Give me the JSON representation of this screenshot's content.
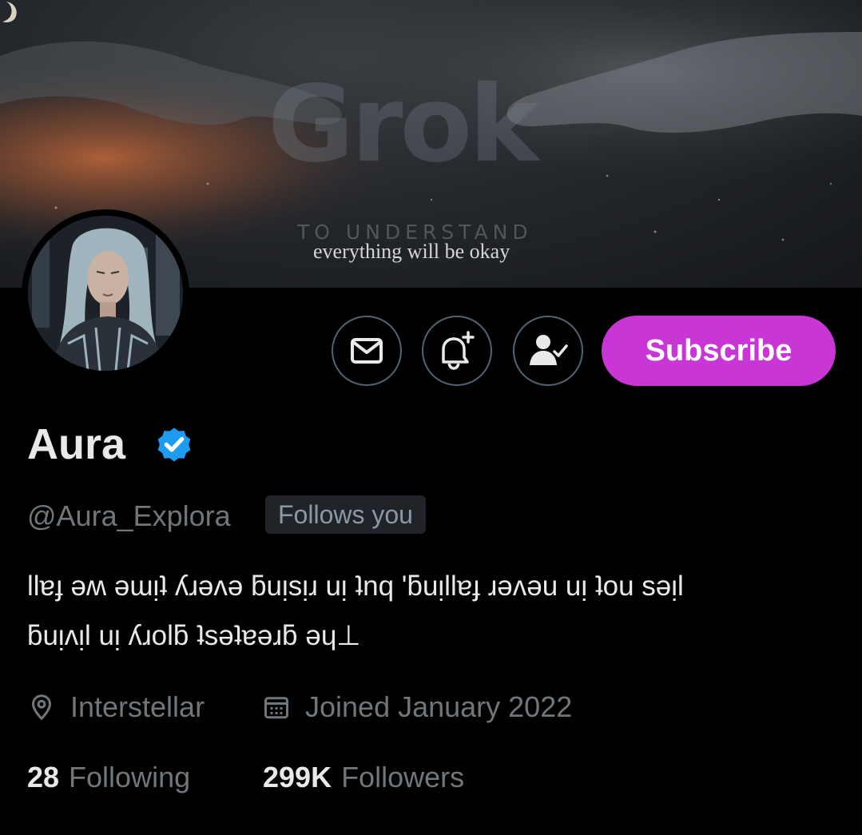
{
  "banner": {
    "logo_text": "Grok",
    "tagline": "TO UNDERSTAND",
    "subtitle": "everything will be okay"
  },
  "profile": {
    "display_name": "Aura",
    "handle": "@Aura_Explora",
    "follows_you_badge": "Follows you",
    "bio_lines": [
      "llɐɟ ǝʍ ǝɯᴉʇ ʎɹǝʌǝ ƃuᴉsᴉɹ uᴉ ʇnq 'ƃuᴉllɐɟ ɹǝʌǝu uᴉ ʇou sǝᴉl",
      "ƃuᴉʌᴉl uᴉ ʎɹolƃ ʇsǝʇɐǝɹƃ ǝɥ⊥"
    ],
    "location": "Interstellar",
    "joined": "Joined January 2022",
    "following_count": "28",
    "following_label": "Following",
    "followers_count": "299K",
    "followers_label": "Followers"
  },
  "actions": {
    "subscribe_label": "Subscribe",
    "icons": [
      "envelope-icon",
      "bell-plus-icon",
      "user-check-icon"
    ]
  },
  "colors": {
    "background": "#000000",
    "primary_text": "#e7e9ea",
    "secondary_text": "#71767b",
    "subscribe": "#c936d6",
    "verified": "#1d9bf0",
    "button_border": "#536471"
  }
}
